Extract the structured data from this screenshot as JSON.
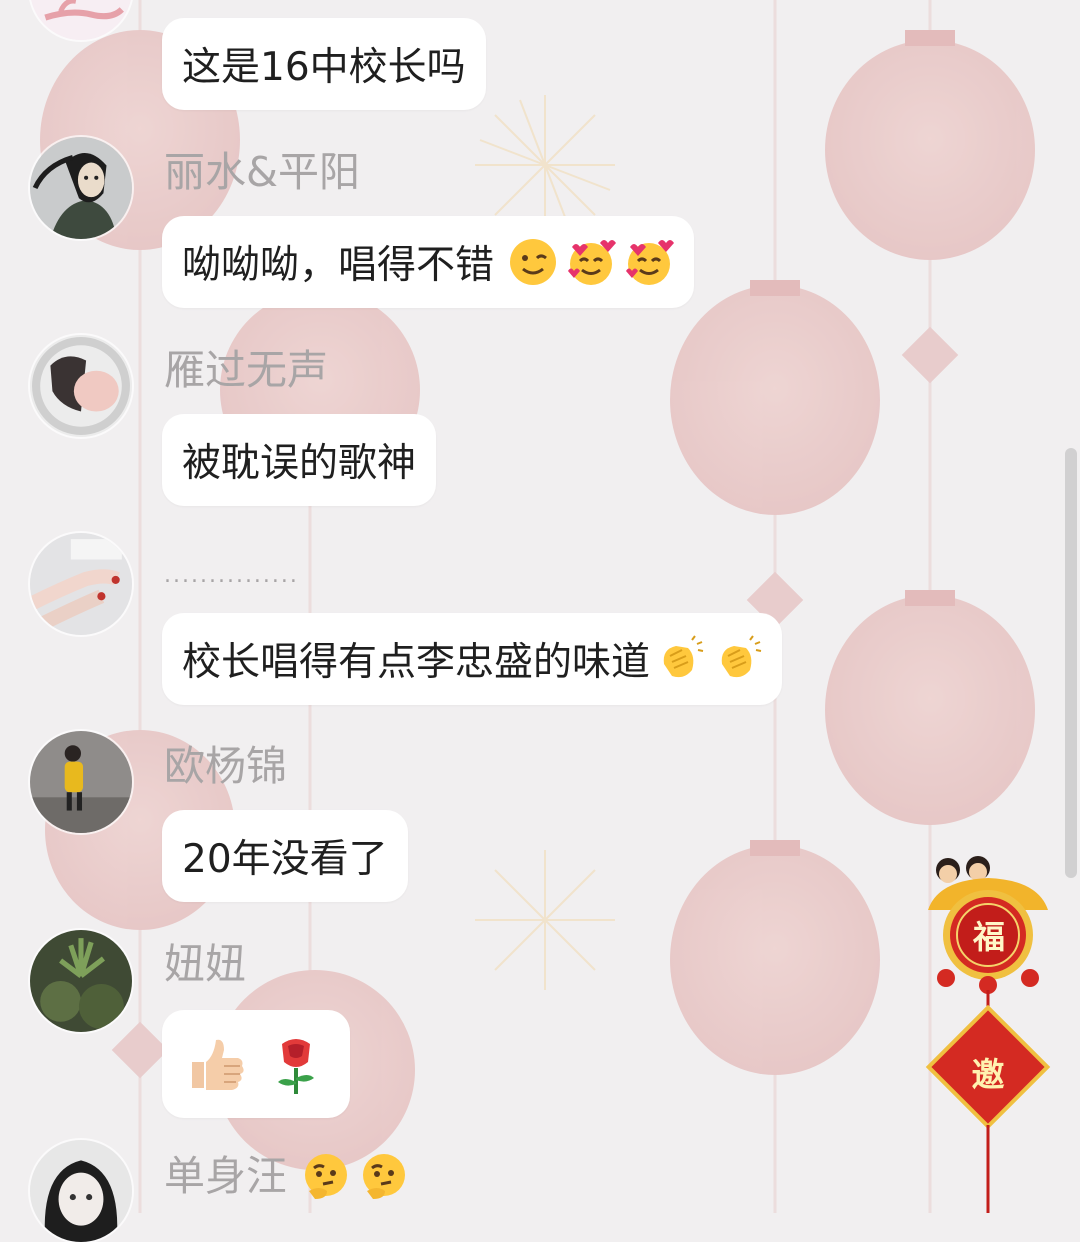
{
  "theme": {
    "background": "#f1eff0",
    "bubble": "#ffffff",
    "name_color": "#a8a5a6",
    "lantern": "#e2a3a3"
  },
  "messages": [
    {
      "sender": "",
      "text": "这是16中校长吗",
      "emojis": []
    },
    {
      "sender": "丽水&平阳",
      "text": "呦呦呦，唱得不错",
      "emojis": [
        "winking-face",
        "smiling-face-with-hearts",
        "smiling-face-with-hearts"
      ]
    },
    {
      "sender": "雁过无声",
      "text": "被耽误的歌神",
      "emojis": []
    },
    {
      "sender": "...............",
      "text": "校长唱得有点李忠盛的味道",
      "emojis": [
        "clapping-hands",
        "clapping-hands"
      ]
    },
    {
      "sender": "欧杨锦",
      "text": "20年没看了",
      "emojis": []
    },
    {
      "sender": "妞妞",
      "text": "",
      "emojis": [
        "thumbs-up",
        "rose"
      ]
    },
    {
      "sender": "单身汪",
      "text": "",
      "emojis": [
        "thinking-face",
        "thinking-face"
      ]
    }
  ],
  "widgets": {
    "fu_label": "福",
    "invite_label": "邀"
  }
}
